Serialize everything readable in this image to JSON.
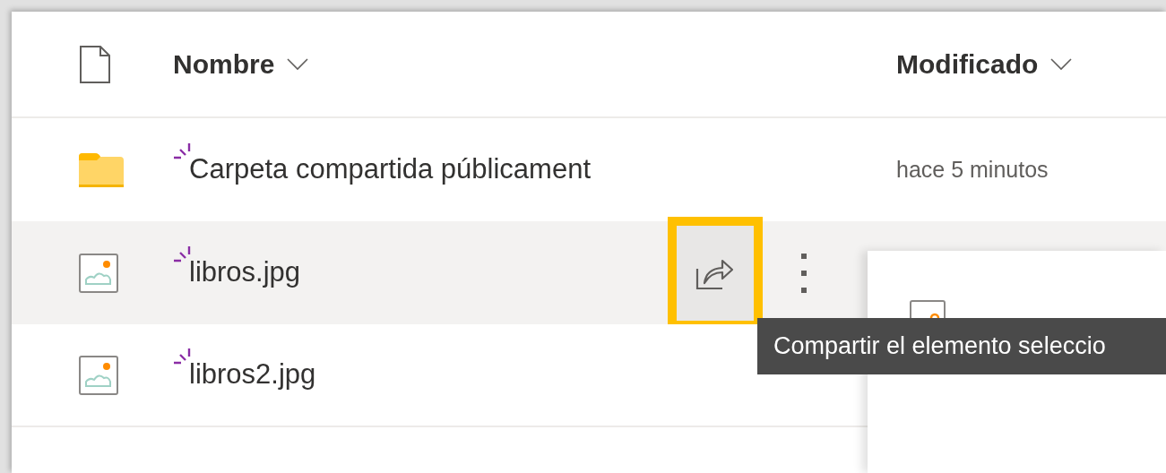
{
  "columns": [
    {
      "label": "Nombre"
    },
    {
      "label": "Modificado"
    }
  ],
  "rows": [
    {
      "kind": "folder",
      "name": "Carpeta compartida públicament",
      "modified": "hace 5 minutos",
      "new": true,
      "hovered": false
    },
    {
      "kind": "image",
      "name": "libros.jpg",
      "new": true,
      "hovered": true,
      "share_button": {
        "highlighted": true
      }
    },
    {
      "kind": "image",
      "name": "libros2.jpg",
      "new": true,
      "hovered": false
    }
  ],
  "preview_panel": {
    "kind": "image"
  },
  "tooltip": {
    "text": "Compartir el elemento seleccio"
  }
}
